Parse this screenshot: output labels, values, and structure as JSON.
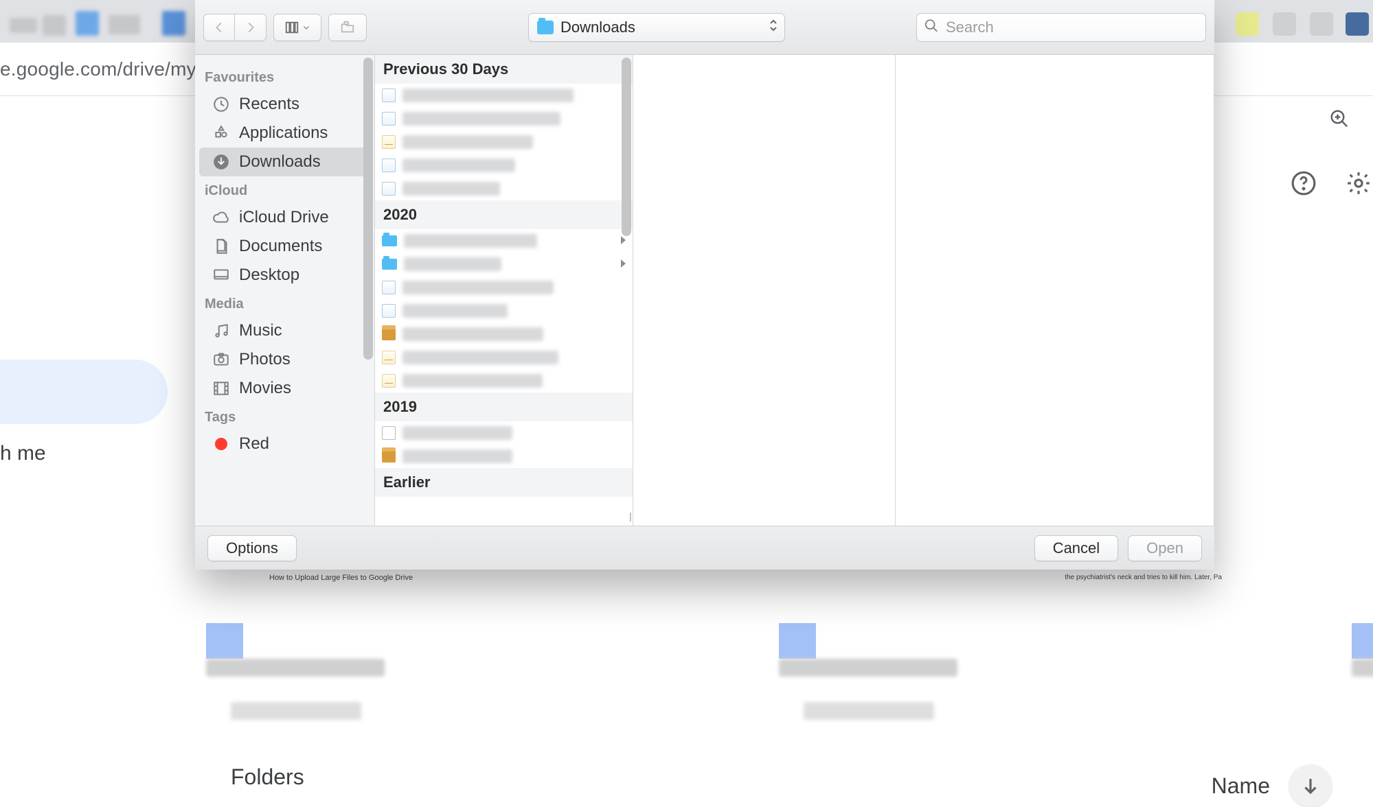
{
  "browser": {
    "url_display": "e.google.com/drive/my-",
    "left_panel_label": "h me",
    "folders_heading": "Folders",
    "sort_label": "Name"
  },
  "dialog": {
    "toolbar": {
      "path_label": "Downloads",
      "search_placeholder": "Search"
    },
    "sidebar": {
      "groups": [
        {
          "label": "Favourites",
          "items": [
            {
              "id": "recents",
              "label": "Recents",
              "icon": "clock"
            },
            {
              "id": "applications",
              "label": "Applications",
              "icon": "apps"
            },
            {
              "id": "downloads",
              "label": "Downloads",
              "icon": "downloads",
              "selected": true
            }
          ]
        },
        {
          "label": "iCloud",
          "items": [
            {
              "id": "icloud-drive",
              "label": "iCloud Drive",
              "icon": "cloud"
            },
            {
              "id": "documents",
              "label": "Documents",
              "icon": "documents"
            },
            {
              "id": "desktop",
              "label": "Desktop",
              "icon": "desktop"
            }
          ]
        },
        {
          "label": "Media",
          "items": [
            {
              "id": "music",
              "label": "Music",
              "icon": "music"
            },
            {
              "id": "photos",
              "label": "Photos",
              "icon": "photos"
            },
            {
              "id": "movies",
              "label": "Movies",
              "icon": "movies"
            }
          ]
        },
        {
          "label": "Tags",
          "items": [
            {
              "id": "tag-red",
              "label": "Red",
              "icon": "tag-red"
            }
          ]
        }
      ]
    },
    "file_column": {
      "sections": [
        {
          "header": "Previous 30 Days",
          "rows": [
            {
              "kind": "doc"
            },
            {
              "kind": "doc"
            },
            {
              "kind": "note"
            },
            {
              "kind": "doc"
            },
            {
              "kind": "doc"
            }
          ]
        },
        {
          "header": "2020",
          "rows": [
            {
              "kind": "folder",
              "chevron": true
            },
            {
              "kind": "folder",
              "chevron": true
            },
            {
              "kind": "doc"
            },
            {
              "kind": "doc"
            },
            {
              "kind": "pkg"
            },
            {
              "kind": "note"
            },
            {
              "kind": "note"
            }
          ]
        },
        {
          "header": "2019",
          "rows": [
            {
              "kind": "dmg"
            },
            {
              "kind": "pkg"
            }
          ]
        },
        {
          "header": "Earlier",
          "rows": []
        }
      ]
    },
    "footer": {
      "options": "Options",
      "cancel": "Cancel",
      "open": "Open"
    }
  },
  "drive_snippets": {
    "bullet": "How to Upload Large Files to Google Drive",
    "right": "the psychiatrist's neck and tries to kill him. Later, Pa"
  }
}
